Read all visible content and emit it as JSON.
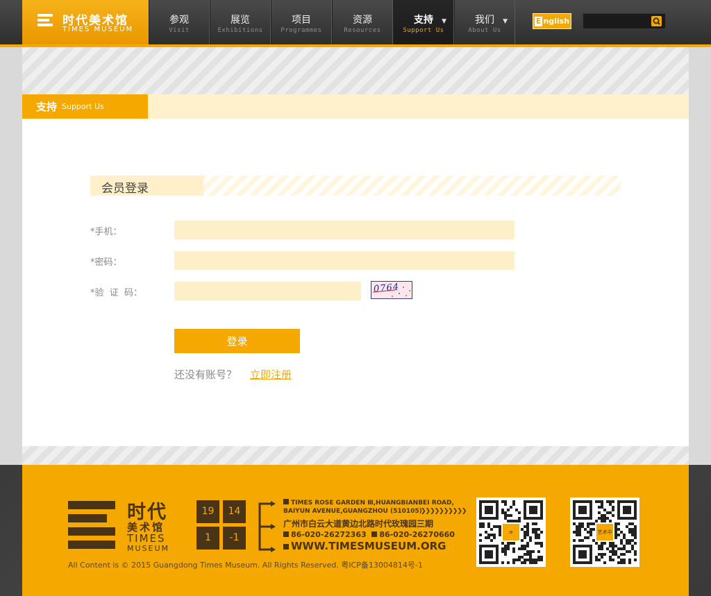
{
  "header": {
    "logo_cn": "时代美术馆",
    "logo_en": "TIMES MUSEUM",
    "nav": [
      {
        "cn": "参观",
        "en": "Visit"
      },
      {
        "cn": "展览",
        "en": "Exhibitions"
      },
      {
        "cn": "项目",
        "en": "Programmes"
      },
      {
        "cn": "资源",
        "en": "Resources"
      },
      {
        "cn": "支持",
        "en": "Support Us"
      },
      {
        "cn": "我们",
        "en": "About Us"
      }
    ],
    "active_nav": "支持",
    "lang_button_prefix": "E",
    "lang_button": "nglish",
    "search_placeholder": ""
  },
  "section": {
    "title_cn": "支持",
    "title_en": "Support Us"
  },
  "form": {
    "title": "会员登录",
    "phone_label": "*手机：",
    "phone_value": "",
    "password_label": "*密码：",
    "password_value": "",
    "captcha_label": "*验  证  码：",
    "captcha_value": "",
    "captcha_image_text": "0764",
    "submit": "登录",
    "no_account": "还没有账号？",
    "register": "立即注册"
  },
  "footer": {
    "logo_cn1": "时代",
    "logo_cn2": "美术馆",
    "logo_en1": "TIMES",
    "logo_en2": "MUSEUM",
    "tiles": [
      "19",
      "14",
      "1",
      "-1"
    ],
    "address_en_1": "TIMES ROSE GARDEN Ⅲ,HUANGBIANBEI ROAD,",
    "address_en_2": "BAIYUN AVENUE,GUANGZHOU (510105)",
    "address_cn": "广州市白云大道黄边北路时代玫瑰园三期",
    "phone_1": "86-020-26272363",
    "phone_2": "86-020-26270660",
    "website": "WWW.TIMESMUSEUM.ORG",
    "copyright": "All Content is © 2015 Guangdong Times Museum. All Rights Reserved. 粤ICP备13004814号-1",
    "qr2_label": "艺术中"
  },
  "colors": {
    "accent": "#f5a800",
    "dark": "#2e2e2e",
    "footer_text": "#4a3417",
    "input_bg": "#fdefc8"
  },
  "icons": {
    "search": "search-icon",
    "dropdown": "chevron-down-icon"
  }
}
